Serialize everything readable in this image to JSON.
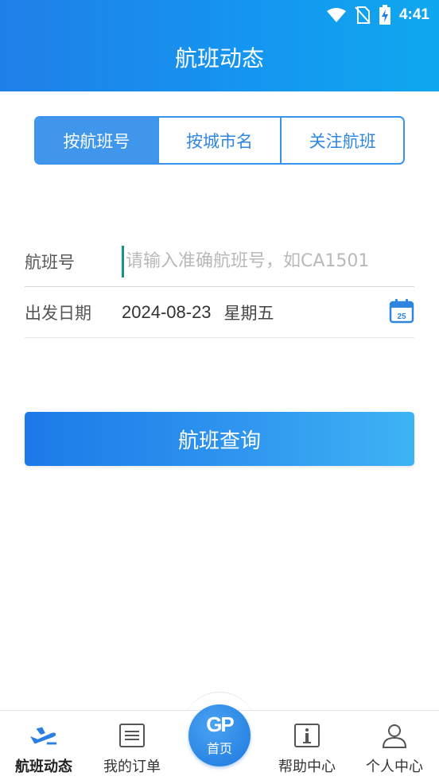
{
  "status_bar": {
    "time": "4:41"
  },
  "header": {
    "title": "航班动态"
  },
  "tabs": [
    {
      "label": "按航班号",
      "active": true
    },
    {
      "label": "按城市名",
      "active": false
    },
    {
      "label": "关注航班",
      "active": false
    }
  ],
  "form": {
    "flight_label": "航班号",
    "flight_placeholder": "请输入准确航班号，如CA1501",
    "flight_value": "",
    "date_label": "出发日期",
    "date_value": "2024-08-23",
    "weekday": "星期五",
    "calendar_day": "25"
  },
  "search_button": {
    "label": "航班查询"
  },
  "bottom_nav": {
    "items": [
      {
        "label": "航班动态",
        "icon": "plane-icon",
        "active": true
      },
      {
        "label": "我的订单",
        "icon": "order-list-icon",
        "active": false
      },
      {
        "label": "首页",
        "icon": "gp-logo-icon",
        "logo_text": "GP",
        "active": false
      },
      {
        "label": "帮助中心",
        "icon": "info-icon",
        "active": false
      },
      {
        "label": "个人中心",
        "icon": "user-icon",
        "active": false
      }
    ]
  },
  "colors": {
    "primary": "#2f86df",
    "accent": "#3f96ea",
    "header_start": "#1f7fe8",
    "header_end": "#0fa8ee"
  }
}
